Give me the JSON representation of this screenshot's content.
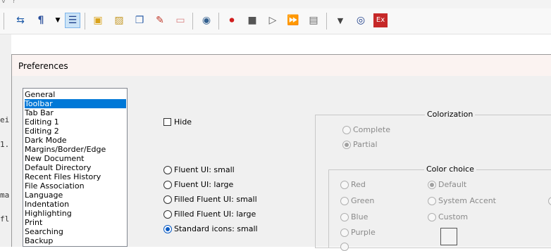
{
  "toolbar": {
    "icons": [
      "wrap-icon",
      "pilcrow-icon",
      "dropdown-arrow-icon",
      "indent-guide-icon",
      "open-folder-icon",
      "image-icon",
      "copy-icon",
      "pdf-icon",
      "folder-icon",
      "eye-icon",
      "record-icon",
      "stop-icon",
      "play-icon",
      "fast-forward-icon",
      "save-macro-icon",
      "chevron-down-icon",
      "globe-icon",
      "exit-icon"
    ]
  },
  "dialog": {
    "title": "Preferences",
    "categories": [
      "General",
      "Toolbar",
      "Tab Bar",
      "Editing 1",
      "Editing 2",
      "Dark Mode",
      "Margins/Border/Edge",
      "New Document",
      "Default Directory",
      "Recent Files History",
      "File Association",
      "Language",
      "Indentation",
      "Highlighting",
      "Print",
      "Searching",
      "Backup"
    ],
    "selected_index": 1,
    "hide_label": "Hide",
    "icon_options": [
      "Fluent UI: small",
      "Fluent UI: large",
      "Filled Fluent UI: small",
      "Filled Fluent UI: large",
      "Standard icons: small"
    ],
    "icon_selected": 4,
    "colorization": {
      "label": "Colorization",
      "options": [
        "Complete",
        "Partial"
      ],
      "selected": 1
    },
    "color_choice": {
      "label": "Color choice",
      "left": [
        "Red",
        "Green",
        "Blue",
        "Purple"
      ],
      "right": [
        "Default",
        "System Accent",
        "Custom"
      ],
      "selected": "Default"
    }
  },
  "editor_text": [
    "ei",
    "1.",
    "ma",
    "fl"
  ]
}
